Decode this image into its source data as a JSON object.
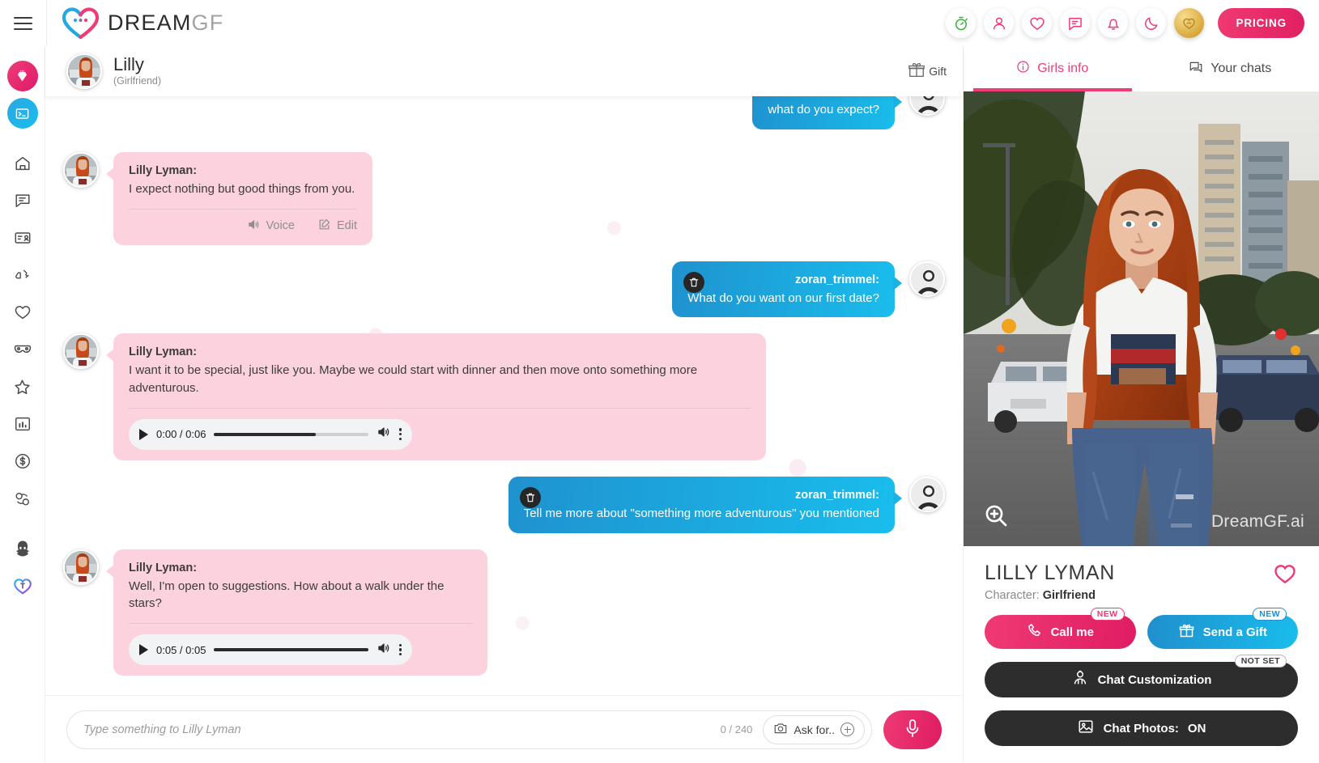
{
  "header": {
    "menu_icon": "hamburger-icon",
    "brand_primary": "DREAM",
    "brand_secondary": "GF",
    "actions": [
      {
        "name": "timer-icon",
        "label": "Free trial timer"
      },
      {
        "name": "user-icon",
        "label": "Profile"
      },
      {
        "name": "heart-icon",
        "label": "Favorites"
      },
      {
        "name": "chat-icon",
        "label": "Chats"
      },
      {
        "name": "bell-icon",
        "label": "Notifications"
      },
      {
        "name": "moon-icon",
        "label": "Dark mode"
      },
      {
        "name": "coin-icon",
        "label": "Coins"
      }
    ],
    "pricing_label": "PRICING"
  },
  "rail": {
    "items": [
      {
        "name": "diamond-icon",
        "label": "Premium"
      },
      {
        "name": "terminal-icon",
        "label": "Console"
      },
      {
        "name": "home-icon",
        "label": "Home"
      },
      {
        "name": "chat-bubble-icon",
        "label": "Chat"
      },
      {
        "name": "card-icon",
        "label": "Card"
      },
      {
        "name": "thumbs-icon",
        "label": "Rate"
      },
      {
        "name": "heart-outline-icon",
        "label": "Favorites"
      },
      {
        "name": "mask-icon",
        "label": "Roleplay"
      },
      {
        "name": "star-icon",
        "label": "Starred"
      },
      {
        "name": "chart-icon",
        "label": "Stats"
      },
      {
        "name": "dollar-icon",
        "label": "Earn"
      },
      {
        "name": "referral-icon",
        "label": "Referrals"
      },
      {
        "name": "anime-icon",
        "label": "Anime"
      },
      {
        "name": "heart-gradient-icon",
        "label": "Trans"
      }
    ]
  },
  "chat_header": {
    "name": "Lilly",
    "subtitle": "(Girlfriend)",
    "gift_label": "Gift",
    "gift_icon": "gift-icon",
    "avatar": "lilly-avatar"
  },
  "messages": [
    {
      "id": "m0",
      "side": "right",
      "sender": "",
      "text": "what do you expect?",
      "partial": true
    },
    {
      "id": "m1",
      "side": "left",
      "sender": "Lilly Lyman:",
      "text": "I expect nothing but good things from you.",
      "actions": [
        {
          "name": "voice-action",
          "icon": "speaker-icon",
          "label": "Voice"
        },
        {
          "name": "edit-action",
          "icon": "pencil-icon",
          "label": "Edit"
        }
      ]
    },
    {
      "id": "m2",
      "side": "right",
      "sender": "zoran_trimmel:",
      "text": "What do you want on our first date?",
      "delete_icon": "trash-icon"
    },
    {
      "id": "m3",
      "side": "left",
      "sender": "Lilly Lyman:",
      "text": "I want it to be special, just like you. Maybe we could start with dinner and then move onto something more adventurous.",
      "audio": {
        "time": "0:00 / 0:06",
        "progress": 66,
        "play_icon": "play-icon",
        "volume_icon": "volume-icon",
        "menu_icon": "kebab-icon"
      }
    },
    {
      "id": "m4",
      "side": "right",
      "sender": "zoran_trimmel:",
      "text": "Tell me more about \"something more adventurous\" you mentioned",
      "delete_icon": "trash-icon"
    },
    {
      "id": "m5",
      "side": "left",
      "sender": "Lilly Lyman:",
      "text": "Well, I'm open to suggestions. How about a walk under the stars?",
      "audio": {
        "time": "0:05 / 0:05",
        "progress": 100,
        "play_icon": "play-icon",
        "volume_icon": "volume-icon",
        "menu_icon": "kebab-icon"
      }
    }
  ],
  "composer": {
    "placeholder": "Type something to Lilly Lyman",
    "value": "",
    "counter": "0 / 240",
    "ask_for_label": "Ask for..",
    "ask_for_icon": "camera-icon",
    "plus_icon": "plus-circle-icon",
    "mic_icon": "microphone-icon"
  },
  "right_panel": {
    "tabs": [
      {
        "name": "tab-girls-info",
        "label": "Girls info",
        "icon": "info-icon",
        "active": true
      },
      {
        "name": "tab-your-chats",
        "label": "Your chats",
        "icon": "chat-icon",
        "active": false
      }
    ],
    "hero": {
      "watermark": "DreamGF.ai",
      "zoom_icon": "zoom-in-icon"
    },
    "character_name": "LILLY LYMAN",
    "character_label": "Character:",
    "character_value": "Girlfriend",
    "favorite_icon": "heart-outline-icon",
    "buttons": [
      {
        "name": "call-me-button",
        "label": "Call me",
        "icon": "phone-icon",
        "badge": "NEW"
      },
      {
        "name": "send-gift-button",
        "label": "Send a Gift",
        "icon": "gift-icon",
        "badge": "NEW"
      }
    ],
    "dark_buttons": [
      {
        "name": "chat-customization-button",
        "label": "Chat Customization",
        "icon": "person-settings-icon",
        "badge": "NOT SET",
        "value": ""
      },
      {
        "name": "chat-photos-button",
        "label": "Chat Photos:",
        "icon": "image-icon",
        "badge": "",
        "value": "ON"
      }
    ]
  },
  "colors": {
    "pink": "#ef3a74",
    "blue": "#19bdec",
    "bubble_her": "#fbd2de",
    "dark": "#2d2d2d"
  }
}
